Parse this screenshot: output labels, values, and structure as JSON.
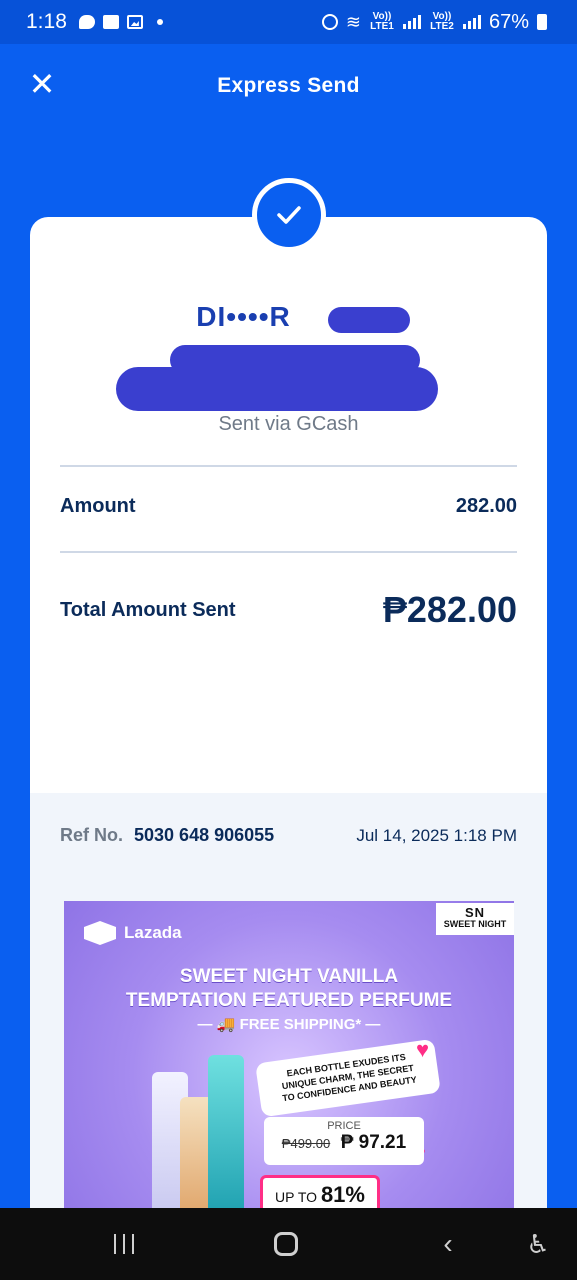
{
  "status_bar": {
    "time": "1:18",
    "lte1": "Vo)) LTE1",
    "lte2": "Vo)) LTE2",
    "battery": "67%"
  },
  "header": {
    "close_icon": "close-icon",
    "title": "Express Send"
  },
  "receipt": {
    "recipient_name": "DI••••R",
    "sent_via": "Sent via GCash",
    "amount_label": "Amount",
    "amount_value": "282.00",
    "total_label": "Total Amount Sent",
    "total_value": "₱282.00",
    "ref_label": "Ref No.",
    "ref_number": "5030 648 906055",
    "date": "Jul 14, 2025 1:18 PM"
  },
  "ad": {
    "brand": "Lazada",
    "partner_logo": "SN",
    "partner_name": "SWEET NIGHT",
    "title_line1": "SWEET NIGHT VANILLA",
    "title_line2": "TEMPTATION FEATURED PERFUME",
    "shipping": "FREE SHIPPING*",
    "tagline_line1": "EACH BOTTLE EXUDES ITS",
    "tagline_line2": "UNIQUE CHARM, THE SECRET",
    "tagline_line3": "TO CONFIDENCE AND BEAUTY",
    "price_label": "PRICE",
    "old_price": "₱499.00",
    "new_price": "₱ 97.21",
    "discount_prefix": "UP TO",
    "discount_value": "81%"
  },
  "colors": {
    "brand_blue": "#0a5ff0",
    "text_navy": "#0b2b5a",
    "muted": "#6f7a88",
    "redaction": "#3a3fcf"
  }
}
